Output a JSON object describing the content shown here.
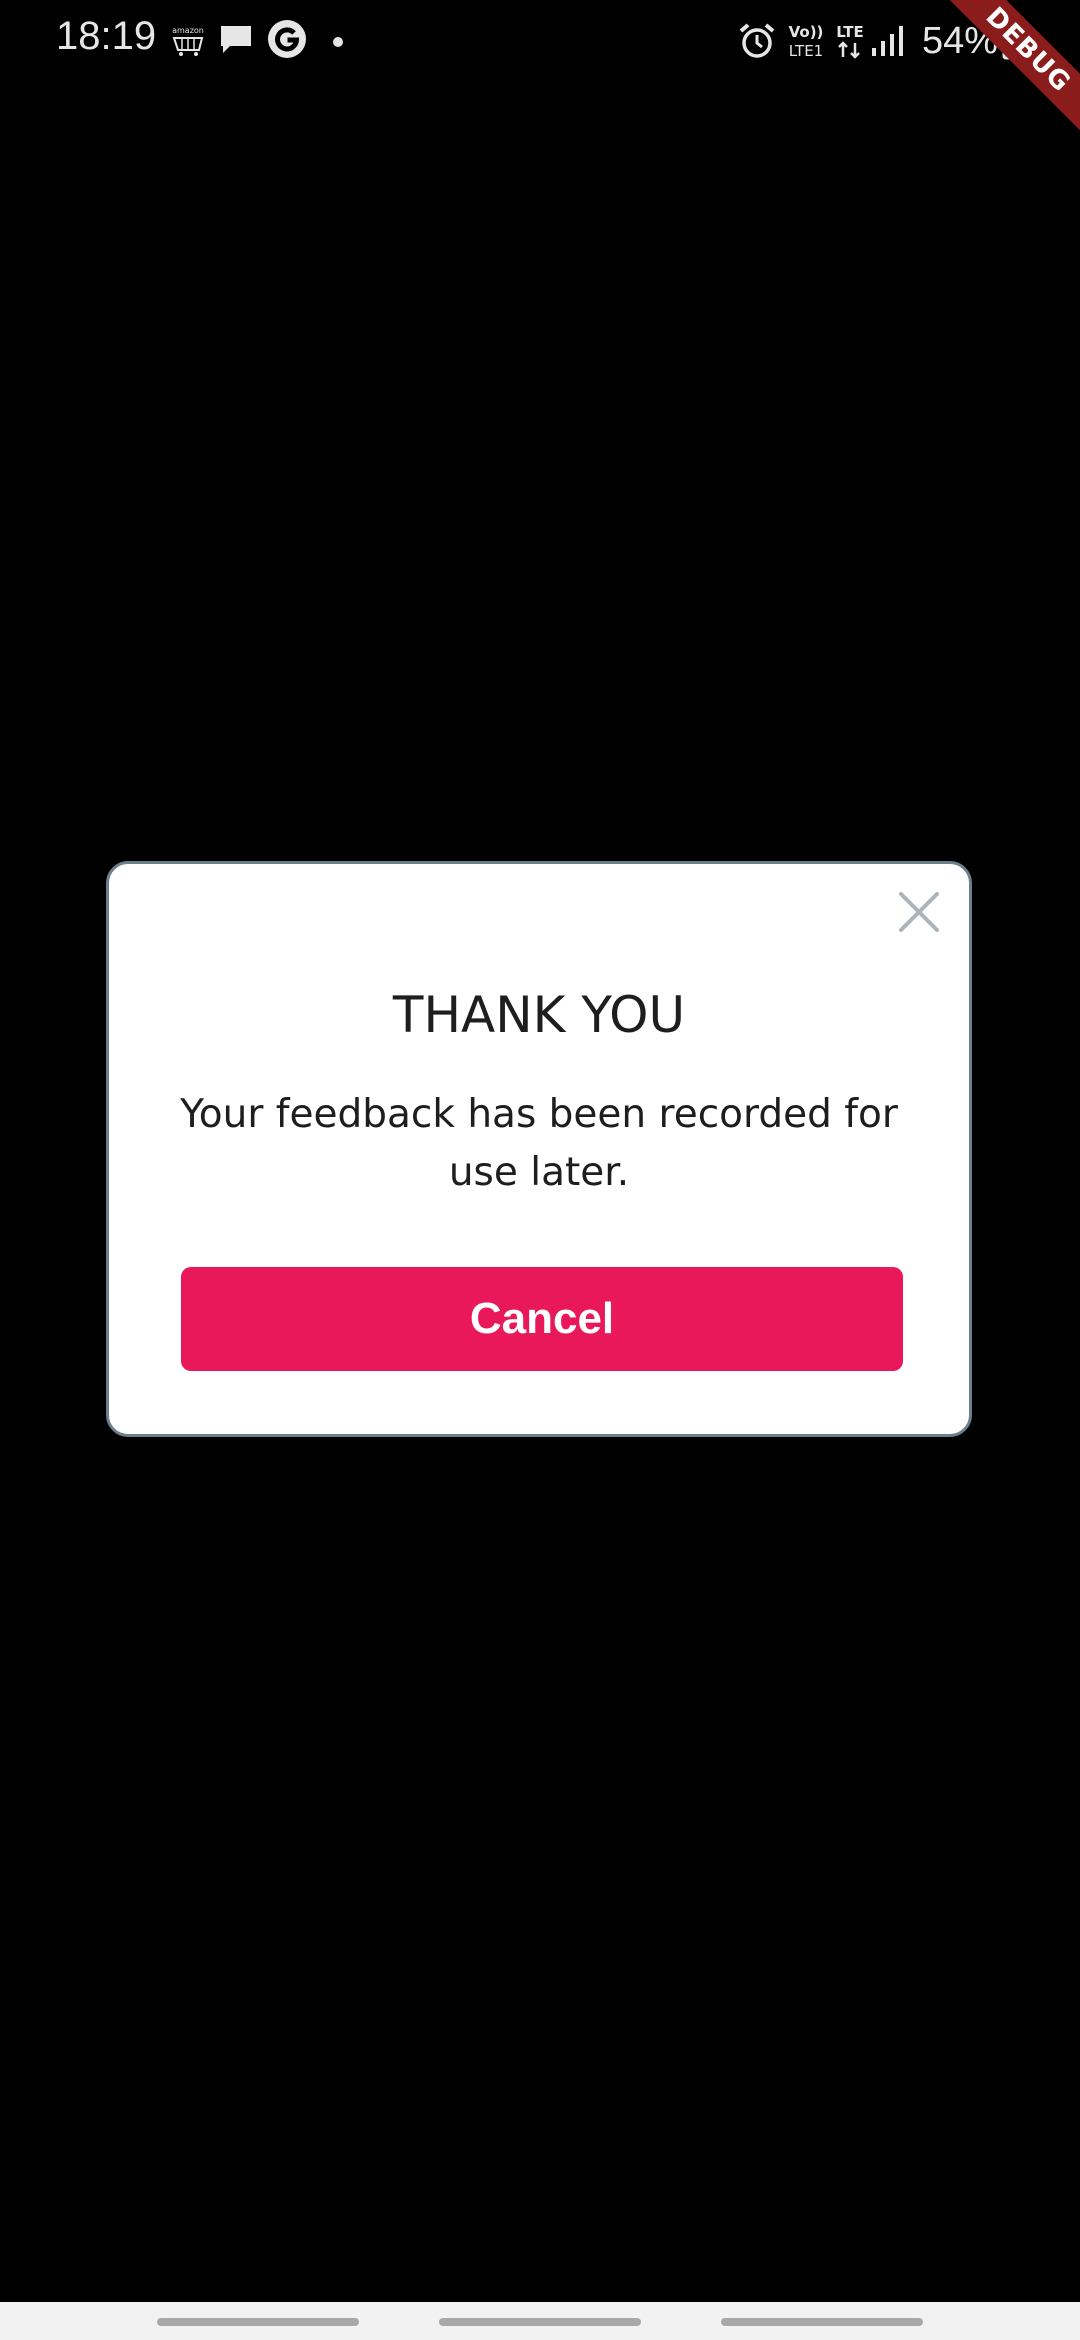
{
  "status_bar": {
    "time": "18:19",
    "amazon_label": "amazon",
    "volte_label": "Vo))",
    "lte1_label": "LTE1",
    "lte_label": "LTE",
    "battery": "54%"
  },
  "debug_banner": "DEBUG",
  "dialog": {
    "title": "THANK YOU",
    "message": "Your feedback has been recorded for use later.",
    "cancel_label": "Cancel"
  },
  "colors": {
    "background": "#000000",
    "accent": "#e8185a",
    "dialog_border": "#6b7f8c",
    "close_icon": "#a9b4bd"
  },
  "icons": {
    "status": [
      "amazon-shopping-icon",
      "message-icon",
      "google-icon",
      "notification-dot-icon",
      "alarm-icon",
      "volte-icon",
      "lte-data-icon",
      "signal-icon",
      "battery-icon"
    ],
    "dialog": [
      "close-icon"
    ]
  }
}
